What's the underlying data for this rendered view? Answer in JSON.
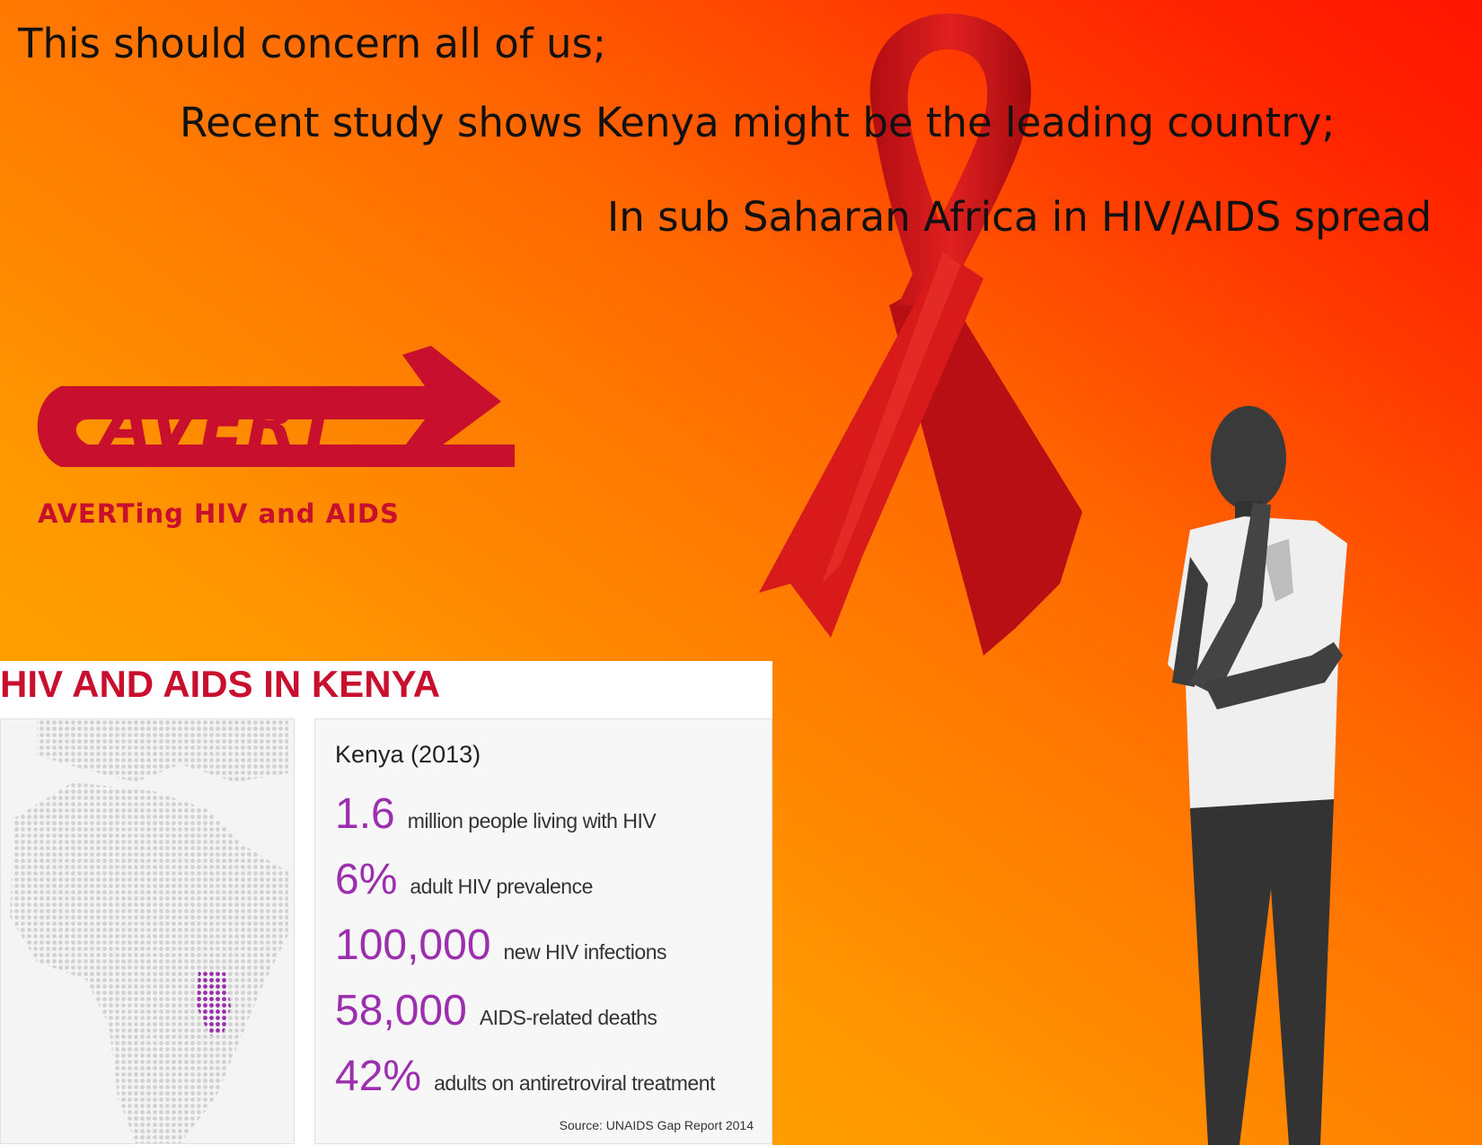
{
  "headlines": [
    "This should concern all of us;",
    "Recent study shows Kenya might be the leading country;",
    "In sub Saharan Africa in HIV/AIDS spread"
  ],
  "logo": {
    "wordmark": "AVERT",
    "tagline": "AVERTing HIV and AIDS",
    "color": "#c8102e"
  },
  "ribbon": {
    "icon": "red-awareness-ribbon",
    "color": "#d4161b"
  },
  "person": {
    "icon": "person-standing-photo"
  },
  "infographic": {
    "title": "HIV AND AIDS IN KENYA",
    "map_icon": "africa-dot-map",
    "highlight_color": "#9b2fae",
    "country_year": "Kenya (2013)",
    "stats": [
      {
        "value": "1.6",
        "label": "million people living with HIV"
      },
      {
        "value": "6%",
        "label": "adult HIV prevalence"
      },
      {
        "value": "100,000",
        "label": "new HIV infections"
      },
      {
        "value": "58,000",
        "label": "AIDS-related deaths"
      },
      {
        "value": "42%",
        "label": "adults on antiretroviral treatment"
      }
    ],
    "source": "Source: UNAIDS Gap Report 2014"
  }
}
